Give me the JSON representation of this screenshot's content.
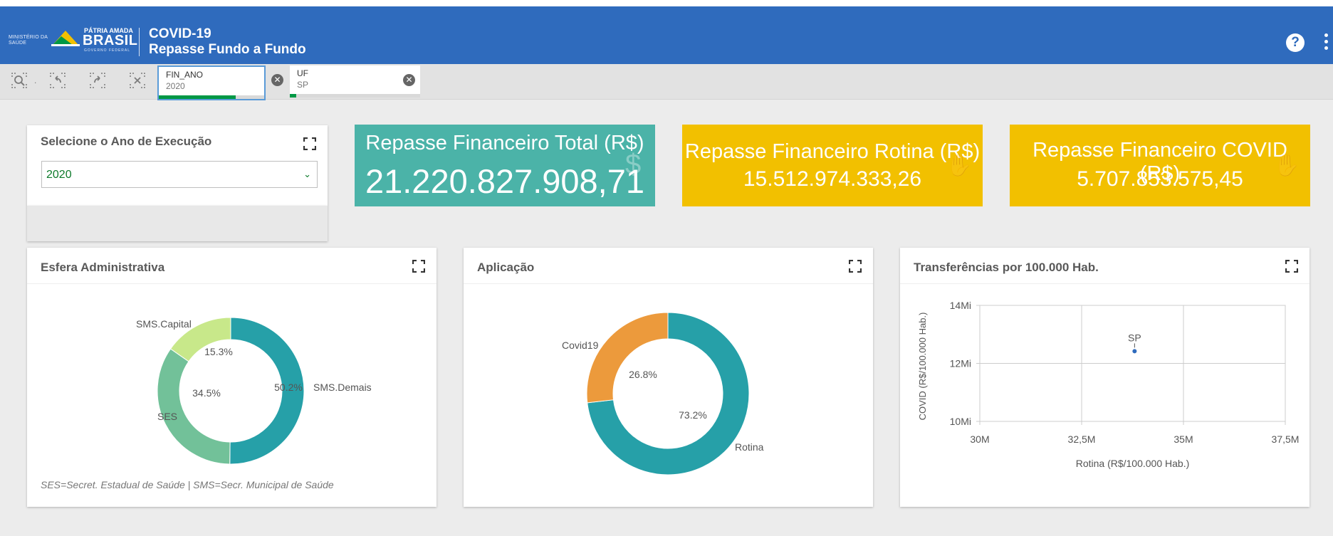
{
  "header": {
    "ministry": "MINISTÉRIO DA SAÚDE",
    "brand_small": "PÁTRIA AMADA",
    "brand": "BRASIL",
    "brand_sub": "GOVERNO FEDERAL",
    "title_line1": "COVID-19",
    "title_line2": "Repasse Fundo a Fundo",
    "help_label": "?"
  },
  "selections": [
    {
      "field": "FIN_ANO",
      "value": "2020",
      "progress": 0.73
    },
    {
      "field": "UF",
      "value": "SP",
      "progress": 0.05
    }
  ],
  "toolbar": {
    "icons": [
      "smart-search-icon",
      "step-back-icon",
      "step-forward-icon",
      "clear-selections-icon"
    ],
    "close_glyph": "✕"
  },
  "year_filter": {
    "title": "Selecione o Ano de Execução",
    "selected": "2020"
  },
  "kpis": [
    {
      "title": "Repasse Financeiro Total (R$)",
      "value": "21.220.827.908,71",
      "color": "#4bb3a8"
    },
    {
      "title": "Repasse Financeiro Rotina (R$)",
      "value": "15.512.974.333,26",
      "color": "#f2c000"
    },
    {
      "title": "Repasse Financeiro COVID (R$)",
      "value": "5.707.853.575,45",
      "color": "#f2c000"
    }
  ],
  "colors": {
    "header": "#2f6bbd",
    "teal": "#26a0a8",
    "green_mid": "#72c199",
    "green_light": "#c8e88a",
    "orange": "#ec9a3c"
  },
  "chart_data": [
    {
      "type": "pie",
      "title": "Esfera Administrativa",
      "donut": true,
      "slices": [
        {
          "label": "SMS.Demais",
          "value": 50.2,
          "display": "50.2%",
          "color": "#26a0a8"
        },
        {
          "label": "SES",
          "value": 34.5,
          "display": "34.5%",
          "color": "#72c199"
        },
        {
          "label": "SMS.Capital",
          "value": 15.3,
          "display": "15.3%",
          "color": "#c8e88a"
        }
      ],
      "footnote": "SES=Secret. Estadual de Saúde | SMS=Secr. Municipal de Saúde"
    },
    {
      "type": "pie",
      "title": "Aplicação",
      "donut": true,
      "slices": [
        {
          "label": "Rotina",
          "value": 73.2,
          "display": "73.2%",
          "color": "#26a0a8"
        },
        {
          "label": "Covid19",
          "value": 26.8,
          "display": "26.8%",
          "color": "#ec9a3c"
        }
      ]
    },
    {
      "type": "scatter",
      "title": "Transferências por 100.000 Hab.",
      "xlabel": "Rotina (R$/100.000 Hab.)",
      "ylabel": "COVID (R$/100.000 Hab.)",
      "xlim": [
        30000000,
        37500000
      ],
      "ylim": [
        10000000,
        14000000
      ],
      "xticks": [
        {
          "v": 30000000,
          "label": "30M"
        },
        {
          "v": 32500000,
          "label": "32,5M"
        },
        {
          "v": 35000000,
          "label": "35M"
        },
        {
          "v": 37500000,
          "label": "37,5M"
        }
      ],
      "yticks": [
        {
          "v": 10000000,
          "label": "10Mi"
        },
        {
          "v": 12000000,
          "label": "12Mi"
        },
        {
          "v": 14000000,
          "label": "14Mi"
        }
      ],
      "points": [
        {
          "label": "SP",
          "x": 33800000,
          "y": 12420000,
          "color": "#2f6bbd"
        }
      ],
      "grid": true
    }
  ]
}
